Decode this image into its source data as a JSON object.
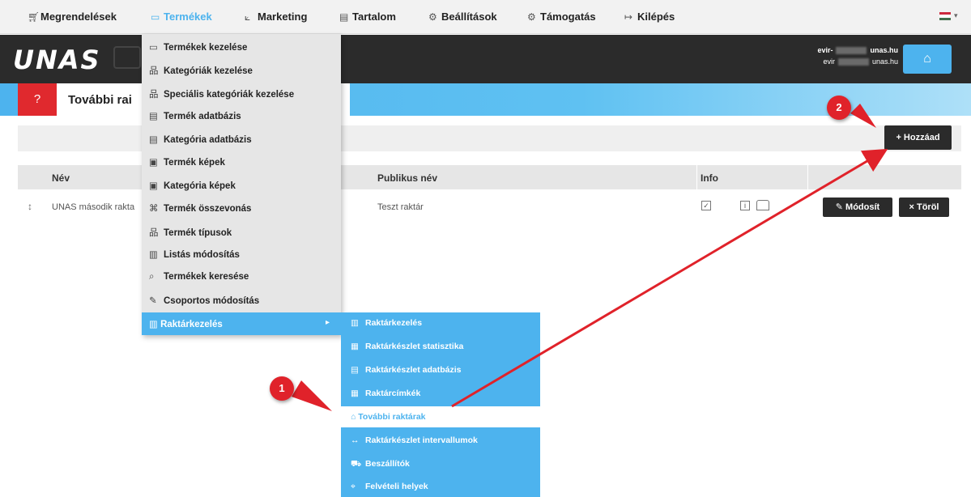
{
  "topmenu": {
    "items": [
      {
        "label": "Megrendelések",
        "icon": "cart-icon"
      },
      {
        "label": "Termékek",
        "icon": "products-icon"
      },
      {
        "label": "Marketing",
        "icon": "chart-icon"
      },
      {
        "label": "Tartalom",
        "icon": "document-icon"
      },
      {
        "label": "Beállítások",
        "icon": "gear-icon"
      },
      {
        "label": "Támogatás",
        "icon": "support-icon"
      },
      {
        "label": "Kilépés",
        "icon": "logout-icon"
      }
    ],
    "active_color": "#4db3ee"
  },
  "header": {
    "logo": "UNAS",
    "account_line1_prefix": "evir-",
    "account_line1_suffix": "unas.hu",
    "account_line2_prefix": "evir",
    "account_line2_suffix": "unas.hu"
  },
  "page": {
    "title": "További rai",
    "help_icon": "?",
    "add_label": "+ Hozzáad"
  },
  "table": {
    "columns": [
      "Név",
      "Publikus név",
      "Info"
    ],
    "rows": [
      {
        "name": "UNAS második rakta",
        "public_name": "Teszt raktár",
        "edit_label": "Módosít",
        "delete_label": "× Töröl"
      }
    ]
  },
  "dropdown": {
    "items": [
      {
        "label": "Termékek kezelése",
        "icon": "▭"
      },
      {
        "label": "Kategóriák kezelése",
        "icon": "品"
      },
      {
        "label": "Speciális kategóriák kezelése",
        "icon": "品"
      },
      {
        "label": "Termék adatbázis",
        "icon": "▤"
      },
      {
        "label": "Kategória adatbázis",
        "icon": "▤"
      },
      {
        "label": "Termék képek",
        "icon": "▣"
      },
      {
        "label": "Kategória képek",
        "icon": "▣"
      },
      {
        "label": "Termék összevonás",
        "icon": "⌘"
      },
      {
        "label": "Termék típusok",
        "icon": "品"
      },
      {
        "label": "Listás módosítás",
        "icon": "▥"
      },
      {
        "label": "Termékek keresése",
        "icon": "⌕"
      },
      {
        "label": "Csoportos módosítás",
        "icon": "✎"
      }
    ],
    "active_item": "Raktárkezelés"
  },
  "submenu": {
    "items": [
      {
        "label": "Raktárkezelés",
        "icon": "▥"
      },
      {
        "label": "Raktárkészlet statisztika",
        "icon": "▦"
      },
      {
        "label": "Raktárkészlet adatbázis",
        "icon": "▤"
      },
      {
        "label": "Raktárcímkék",
        "icon": "▦"
      },
      {
        "label": "Raktárkészlet intervallumok",
        "icon": "↔"
      },
      {
        "label": "Beszállítók",
        "icon": "⛟"
      },
      {
        "label": "Felvételi helyek",
        "icon": "⌖"
      }
    ],
    "active_item": "További raktárak"
  },
  "annotations": {
    "badge1": "1",
    "badge2": "2",
    "color": "#e0222a"
  }
}
